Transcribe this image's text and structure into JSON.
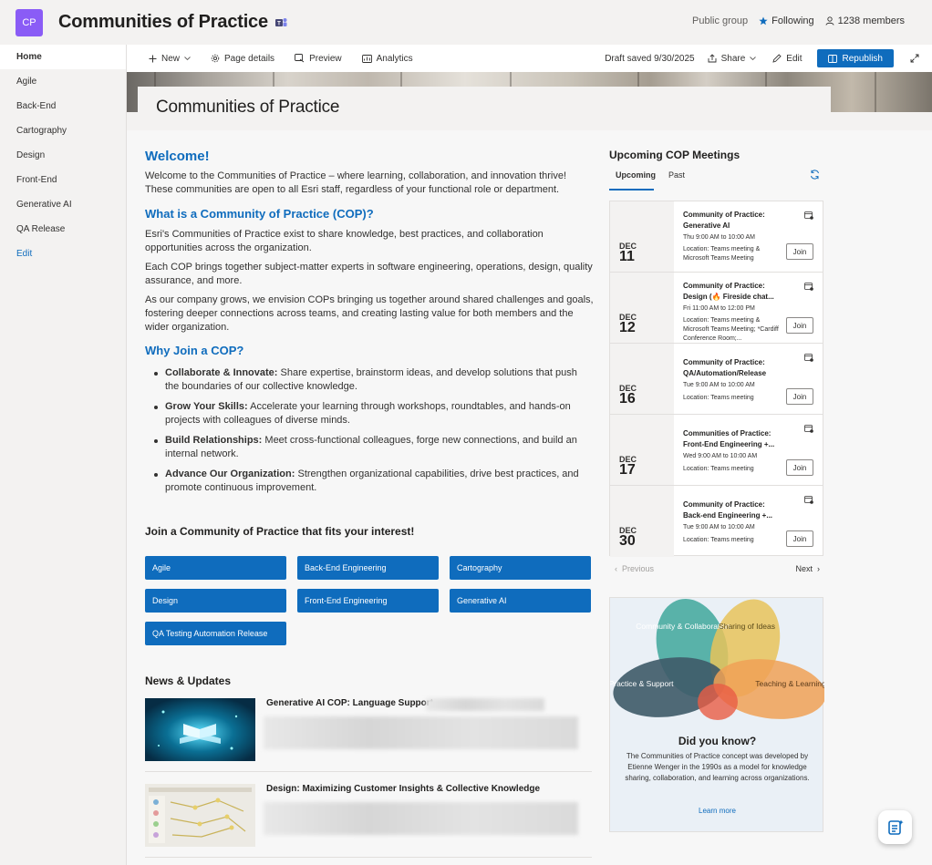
{
  "site": {
    "logo_text": "CP",
    "title": "Communities of Practice",
    "visibility": "Public group",
    "following": "Following",
    "members": "1238 members"
  },
  "nav": {
    "items": [
      "Home",
      "Agile",
      "Back-End",
      "Cartography",
      "Design",
      "Front-End",
      "Generative AI",
      "QA Release"
    ],
    "edit": "Edit"
  },
  "commands": {
    "new": "New",
    "page_details": "Page details",
    "preview": "Preview",
    "analytics": "Analytics",
    "draft": "Draft saved 9/30/2025",
    "share": "Share",
    "edit": "Edit",
    "republish": "Republish"
  },
  "page": {
    "title": "Communities of Practice"
  },
  "content": {
    "welcome_heading": "Welcome!",
    "welcome_text": "Welcome to the Communities of Practice – where learning, collaboration, and innovation thrive! These communities are open to all Esri staff, regardless of your functional role or department.",
    "what_heading": "What is a Community of Practice (COP)?",
    "what_p1": "Esri's Communities of Practice exist to share knowledge, best practices, and collaboration opportunities across the organization.",
    "what_p2": "Each COP brings together subject-matter experts in software engineering, operations, design, quality assurance, and more.",
    "what_p3": "As our company grows, we envision COPs bringing us together around shared challenges and goals, fostering deeper connections across teams, and creating lasting value for both members and the wider organization.",
    "why_heading": "Why Join a COP?",
    "bullets": [
      {
        "bold": "Collaborate & Innovate:",
        "text": " Share expertise, brainstorm ideas, and develop solutions that push the boundaries of our collective knowledge."
      },
      {
        "bold": "Grow Your Skills:",
        "text": " Accelerate your learning through workshops, roundtables, and hands-on projects with colleagues of diverse minds."
      },
      {
        "bold": "Build Relationships:",
        "text": " Meet cross-functional colleagues, forge new connections, and build an internal network."
      },
      {
        "bold": "Advance Our Organization:",
        "text": " Strengthen organizational capabilities, drive best practices, and promote continuous improvement."
      }
    ],
    "join_heading": "Join a Community of Practice that fits your interest!",
    "cop_buttons": [
      "Agile",
      "Back-End Engineering",
      "Cartography",
      "Design",
      "Front-End Engineering",
      "Generative AI",
      "QA Testing Automation Release"
    ],
    "news_heading": "News & Updates",
    "news": [
      {
        "headline": "Generative AI COP: Language Support"
      },
      {
        "headline": "Design: Maximizing Customer Insights & Collective Knowledge"
      }
    ]
  },
  "meetings": {
    "heading": "Upcoming COP Meetings",
    "tabs": [
      "Upcoming",
      "Past"
    ],
    "events": [
      {
        "month": "DEC",
        "day": "11",
        "name": "Community of Practice: Generative AI",
        "time": "Thu 9:00 AM to 10:00 AM",
        "location": "Location: Teams meeting & Microsoft Teams Meeting"
      },
      {
        "month": "DEC",
        "day": "12",
        "name": "Community of Practice: Design (🔥 Fireside chat...",
        "time": "Fri 11:00 AM to 12:00 PM",
        "location": "Location: Teams meeting & Microsoft Teams Meeting; *Cardiff Conference Room;..."
      },
      {
        "month": "DEC",
        "day": "16",
        "name": "Community of Practice: QA/Automation/Release",
        "time": "Tue 9:00 AM to 10:00 AM",
        "location": "Location: Teams meeting"
      },
      {
        "month": "DEC",
        "day": "17",
        "name": "Communities of Practice: Front-End Engineering +...",
        "time": "Wed 9:00 AM to 10:00 AM",
        "location": "Location: Teams meeting"
      },
      {
        "month": "DEC",
        "day": "30",
        "name": "Community of Practice: Back-end Engineering +...",
        "time": "Tue 9:00 AM to 10:00 AM",
        "location": "Location: Teams meeting"
      }
    ],
    "join_label": "Join",
    "previous": "Previous",
    "next": "Next"
  },
  "did_you_know": {
    "venn": [
      "Community & Collaboration",
      "Sharing of Ideas",
      "Practice & Support",
      "Teaching & Learning"
    ],
    "title": "Did you know?",
    "text": "The Communities of Practice concept was developed by Etienne Wenger in the 1990s as a model for knowledge sharing, collaboration, and learning across organizations.",
    "link": "Learn more"
  },
  "colors": {
    "accent": "#0f6cbd",
    "logo": "#8a5cf6",
    "venn_teal": "#3fa79b",
    "venn_yellow": "#e8c35a",
    "venn_slate": "#3e5a68",
    "venn_orange": "#f0a156"
  }
}
